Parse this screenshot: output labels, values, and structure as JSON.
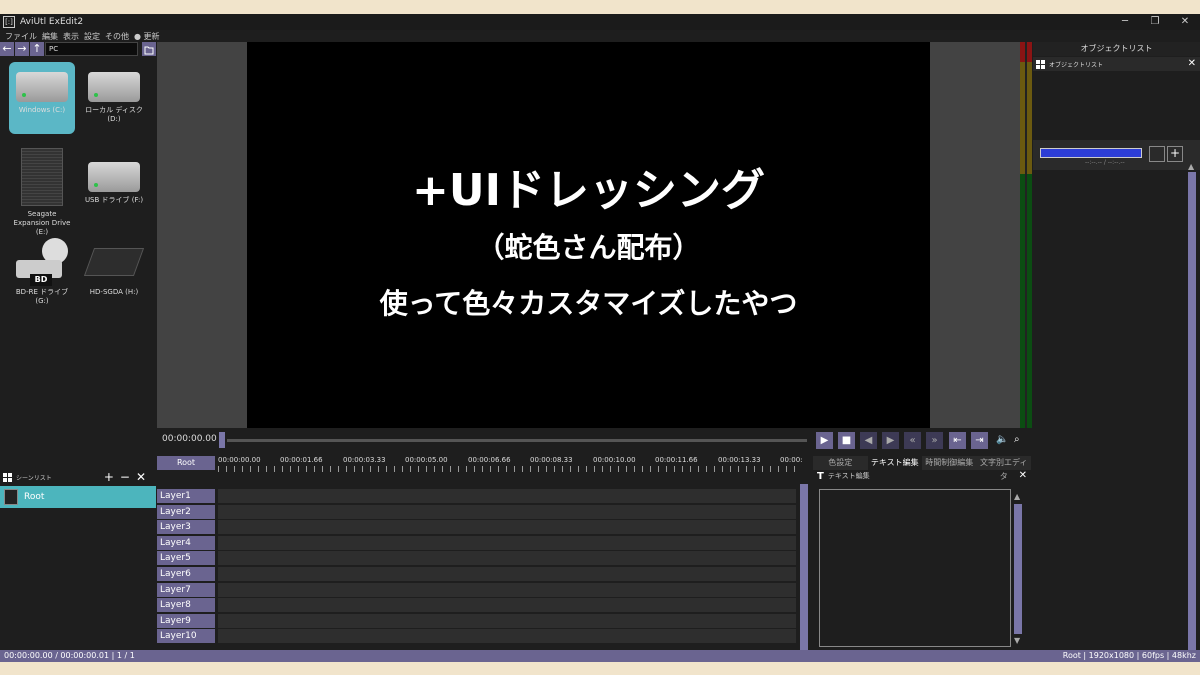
{
  "window": {
    "title": "AviUtl ExEdit2",
    "icon_label": "[:]",
    "controls": [
      "─",
      "❐",
      "✕"
    ]
  },
  "menu": {
    "items": [
      "ファイル",
      "編集",
      "表示",
      "設定",
      "その他",
      "● 更新"
    ]
  },
  "explorer": {
    "path": "PC",
    "drives": [
      {
        "label": "Windows (C:)",
        "icon": "hdd-windows-icon",
        "selected": true
      },
      {
        "label": "ローカル ディスク (D:)",
        "icon": "hdd-icon",
        "selected": false
      },
      {
        "label": "Seagate Expansion Drive (E:)",
        "icon": "external-drive-icon",
        "selected": false
      },
      {
        "label": "USB ドライブ (F:)",
        "icon": "hdd-icon",
        "selected": false
      },
      {
        "label": "BD-RE ドライブ (G:)",
        "icon": "bd-drive-icon",
        "selected": false
      },
      {
        "label": "HD-SGDA (H:)",
        "icon": "external-hdd-icon",
        "selected": false
      }
    ],
    "bd_tag": "BD"
  },
  "scene_list": {
    "title": "シーンリスト",
    "root": "Root"
  },
  "preview": {
    "line1": "+UIドレッシング",
    "line2": "（蛇色さん配布）",
    "line3": "使って色々カスタマイズしたやつ"
  },
  "transport": {
    "timecode": "00:00:00.00"
  },
  "timeline": {
    "root_button": "Root",
    "ruler": [
      "00:00:00.00",
      "00:00:01.66",
      "00:00:03.33",
      "00:00:05.00",
      "00:00:06.66",
      "00:00:08.33",
      "00:00:10.00",
      "00:00:11.66",
      "00:00:13.33",
      "00:00:"
    ],
    "layers": [
      "Layer1",
      "Layer2",
      "Layer3",
      "Layer4",
      "Layer5",
      "Layer6",
      "Layer7",
      "Layer8",
      "Layer9",
      "Layer10"
    ]
  },
  "tabs": [
    "色設定",
    "テキスト編集",
    "時間制御編集",
    "文字別エディタ"
  ],
  "text_panel": {
    "title": "テキスト編集"
  },
  "object_list": {
    "title": "オブジェクトリスト",
    "header": "オブジェクトリスト",
    "time": "--:--.-- / --:--.--"
  },
  "status": {
    "left": "00:00:00.00 / 00:00:00.01  |  1 / 1",
    "right": "Root  |  1920x1080  |  60fps  |  48khz"
  }
}
